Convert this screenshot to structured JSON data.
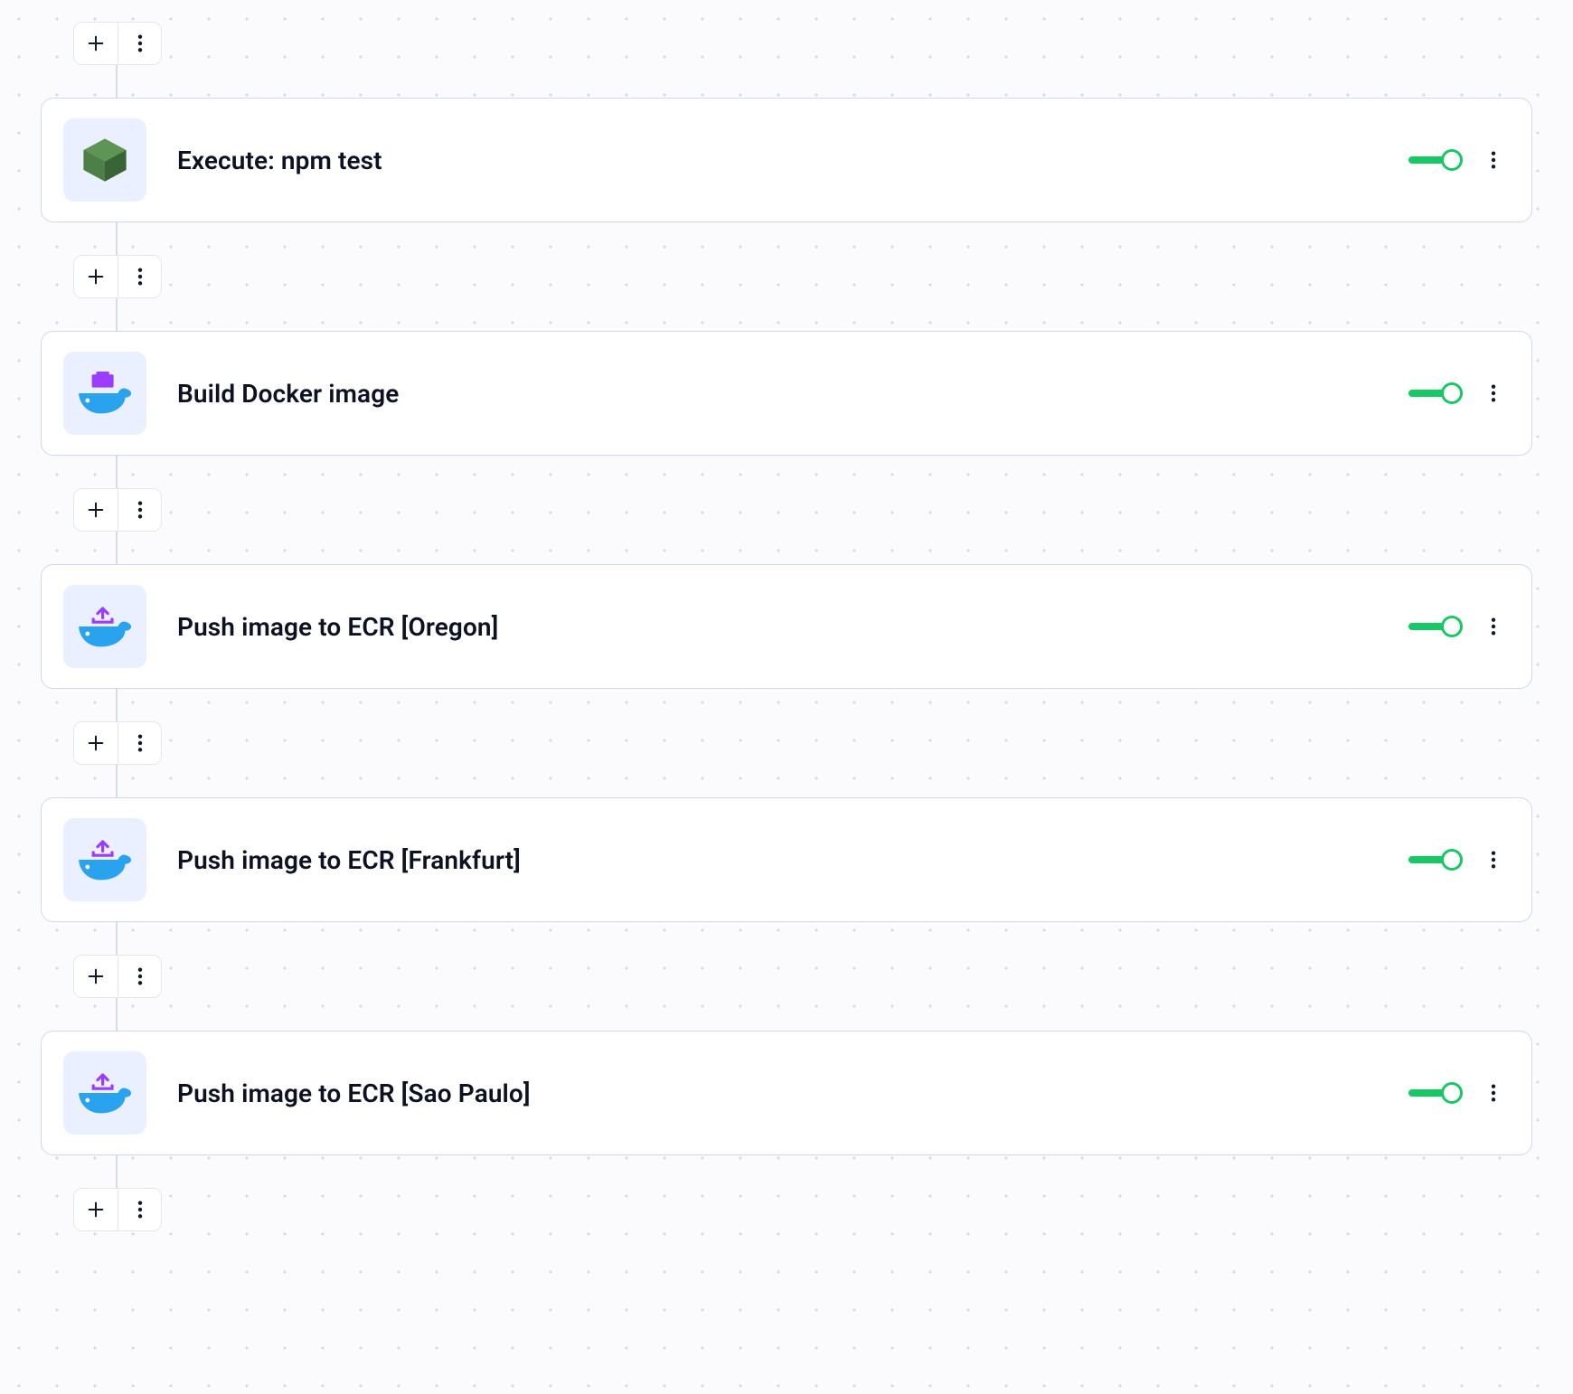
{
  "colors": {
    "card_border": "#cfd9f2",
    "icon_tile_bg": "#eaf0ff",
    "toggle_on": "#17c964",
    "dot_bg": "#d6dae2",
    "docker_blue": "#2aa3ef",
    "purple": "#9b3dff",
    "cube_green_dark": "#3f6d3a",
    "cube_green_light": "#5f9457"
  },
  "steps": [
    {
      "icon": "cube",
      "title": "Execute: npm test",
      "enabled": true
    },
    {
      "icon": "docker-build",
      "title": "Build Docker image",
      "enabled": true
    },
    {
      "icon": "docker-push",
      "title": "Push image to ECR [Oregon]",
      "enabled": true
    },
    {
      "icon": "docker-push",
      "title": "Push image to ECR [Frankfurt]",
      "enabled": true
    },
    {
      "icon": "docker-push",
      "title": "Push image to ECR [Sao Paulo]",
      "enabled": true
    }
  ]
}
